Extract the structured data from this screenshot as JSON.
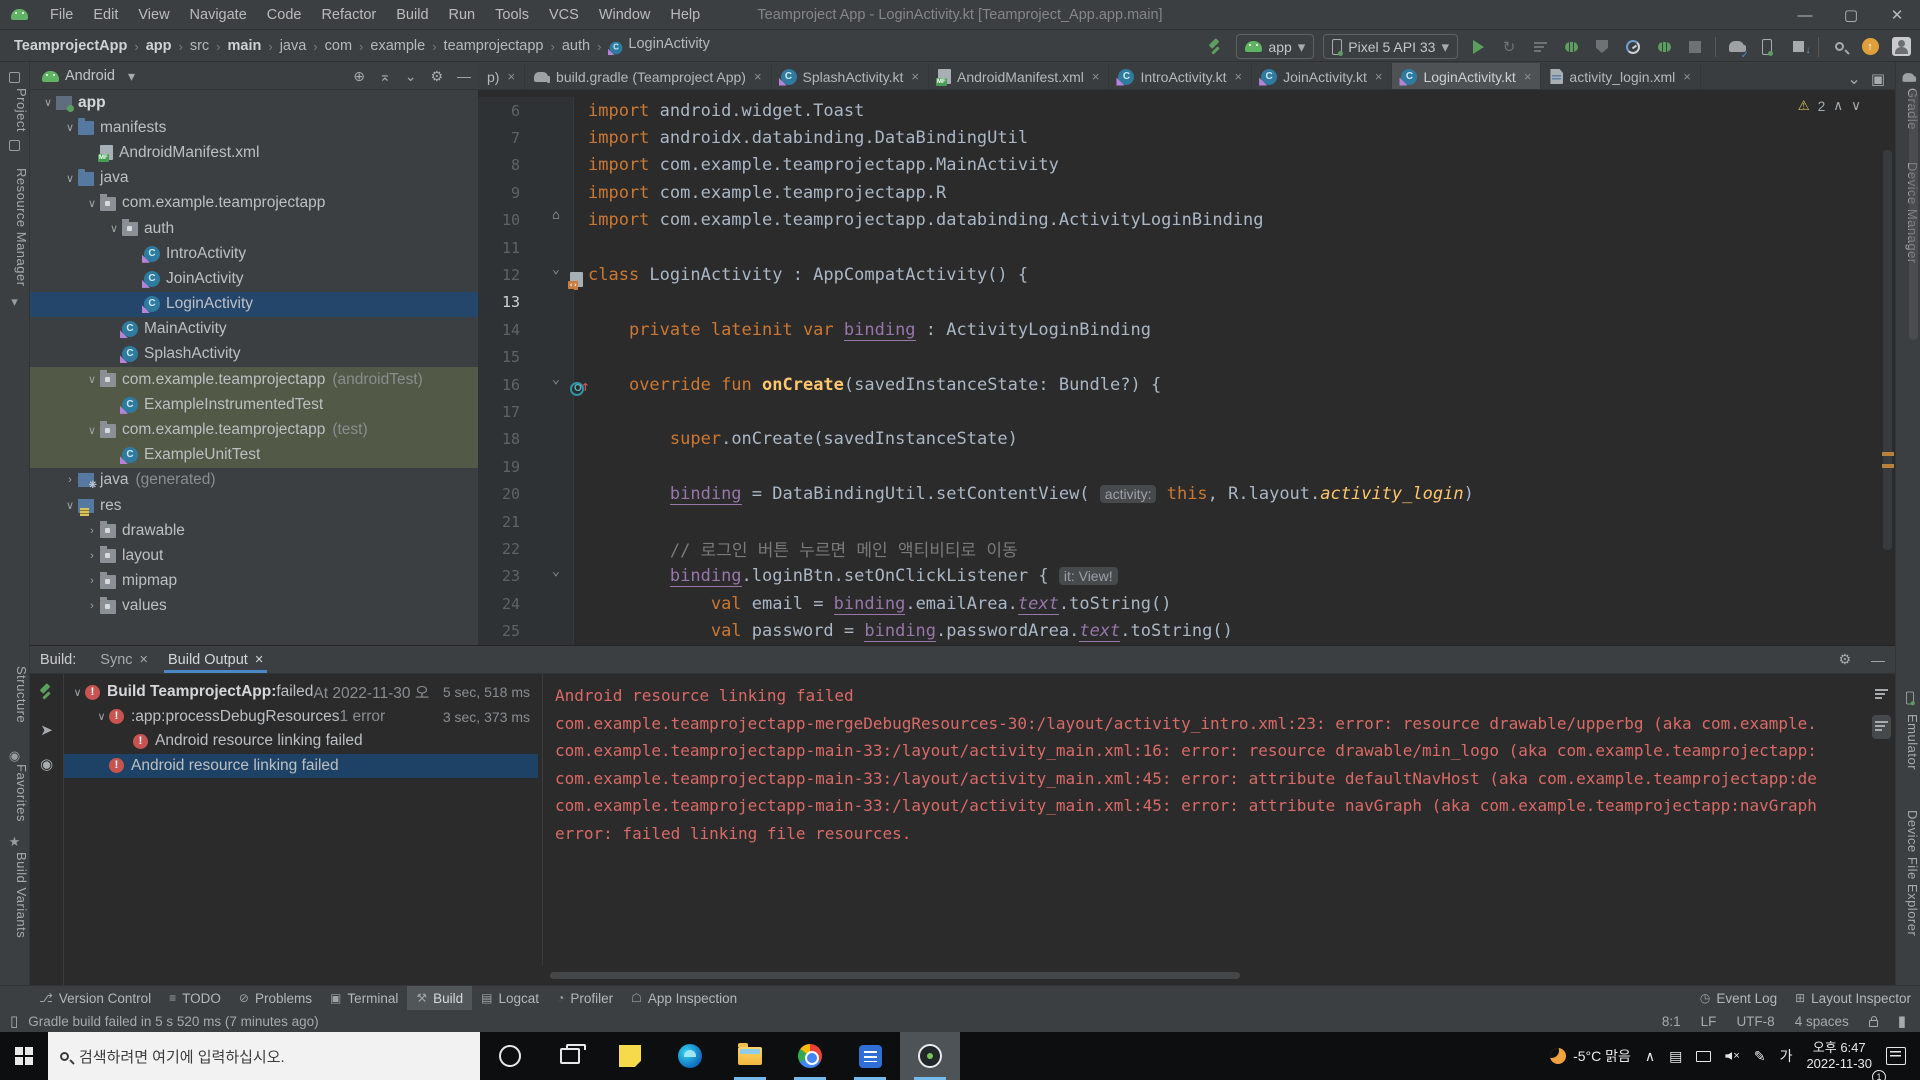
{
  "titlebar": {
    "title": "Teamproject App - LoginActivity.kt [Teamproject_App.app.main]",
    "menus": [
      "File",
      "Edit",
      "View",
      "Navigate",
      "Code",
      "Refactor",
      "Build",
      "Run",
      "Tools",
      "VCS",
      "Window",
      "Help"
    ],
    "window_controls": {
      "minimize": "—",
      "maximize": "▢",
      "close": "✕"
    }
  },
  "toolbar": {
    "breadcrumbs": [
      {
        "label": "TeamprojectApp",
        "bold": true
      },
      {
        "label": "app",
        "bold": true
      },
      {
        "label": "src",
        "bold": false
      },
      {
        "label": "main",
        "bold": true
      },
      {
        "label": "java",
        "bold": false
      },
      {
        "label": "com",
        "bold": false
      },
      {
        "label": "example",
        "bold": false
      },
      {
        "label": "teamprojectapp",
        "bold": false
      },
      {
        "label": "auth",
        "bold": false
      },
      {
        "label": "LoginActivity",
        "bold": false,
        "icon": "kotlin-class"
      }
    ],
    "run_config": "app",
    "device": "Pixel 5 API 33"
  },
  "left_strip": {
    "top": [
      "Project",
      "Resource Manager"
    ],
    "bottom": [
      "Structure",
      "Favorites",
      "Build Variants"
    ]
  },
  "right_strip": {
    "top": [
      "Gradle",
      "Device Manager"
    ],
    "bottom": [
      "Emulator",
      "Device File Explorer"
    ]
  },
  "project": {
    "view": "Android",
    "tree": [
      {
        "label": "app",
        "depth": 0,
        "icon": "app",
        "chev": "v",
        "bold": true
      },
      {
        "label": "manifests",
        "depth": 1,
        "icon": "folder",
        "chev": "v"
      },
      {
        "label": "AndroidManifest.xml",
        "depth": 2,
        "icon": "mf",
        "chev": ""
      },
      {
        "label": "java",
        "depth": 1,
        "icon": "folder",
        "chev": "v"
      },
      {
        "label": "com.example.teamprojectapp",
        "depth": 2,
        "icon": "pkg",
        "chev": "v"
      },
      {
        "label": "auth",
        "depth": 3,
        "icon": "pkg",
        "chev": "v"
      },
      {
        "label": "IntroActivity",
        "depth": 4,
        "icon": "kclass",
        "chev": ""
      },
      {
        "label": "JoinActivity",
        "depth": 4,
        "icon": "kclass",
        "chev": ""
      },
      {
        "label": "LoginActivity",
        "depth": 4,
        "icon": "kclass",
        "chev": "",
        "state": "sel"
      },
      {
        "label": "MainActivity",
        "depth": 3,
        "icon": "kclass",
        "chev": ""
      },
      {
        "label": "SplashActivity",
        "depth": 3,
        "icon": "kclass",
        "chev": ""
      },
      {
        "label": "com.example.teamprojectapp",
        "meta": "(androidTest)",
        "depth": 2,
        "icon": "pkg",
        "chev": "v",
        "state": "olive"
      },
      {
        "label": "ExampleInstrumentedTest",
        "depth": 3,
        "icon": "kclass",
        "chev": "",
        "state": "olive"
      },
      {
        "label": "com.example.teamprojectapp",
        "meta": "(test)",
        "depth": 2,
        "icon": "pkg",
        "chev": "v",
        "state": "olive"
      },
      {
        "label": "ExampleUnitTest",
        "depth": 3,
        "icon": "kclass",
        "chev": "",
        "state": "olive"
      },
      {
        "label": "java",
        "meta": "(generated)",
        "depth": 1,
        "icon": "gen",
        "chev": ">"
      },
      {
        "label": "res",
        "depth": 1,
        "icon": "res",
        "chev": "v"
      },
      {
        "label": "drawable",
        "depth": 2,
        "icon": "pkg",
        "chev": ">"
      },
      {
        "label": "layout",
        "depth": 2,
        "icon": "pkg",
        "chev": ">"
      },
      {
        "label": "mipmap",
        "depth": 2,
        "icon": "pkg",
        "chev": ">"
      },
      {
        "label": "values",
        "depth": 2,
        "icon": "pkg",
        "chev": ">"
      }
    ]
  },
  "editor": {
    "tabs": [
      {
        "label": "p)",
        "icon": "",
        "active": false
      },
      {
        "label": "build.gradle (Teamproject App)",
        "icon": "gradleT",
        "active": false
      },
      {
        "label": "SplashActivity.kt",
        "icon": "kclass",
        "active": false
      },
      {
        "label": "AndroidManifest.xml",
        "icon": "mf",
        "active": false
      },
      {
        "label": "IntroActivity.kt",
        "icon": "kclass",
        "active": false
      },
      {
        "label": "JoinActivity.kt",
        "icon": "kclass",
        "active": false
      },
      {
        "label": "LoginActivity.kt",
        "icon": "kclass",
        "active": true
      },
      {
        "label": "activity_login.xml",
        "icon": "xml",
        "active": false
      }
    ],
    "warning_count": "2",
    "lines": [
      {
        "num": "6",
        "seg": [
          [
            "k",
            "import "
          ],
          [
            "d",
            "android.widget.Toast"
          ]
        ]
      },
      {
        "num": "7",
        "seg": [
          [
            "k",
            "import "
          ],
          [
            "d",
            "androidx.databinding.DataBindingUtil"
          ]
        ]
      },
      {
        "num": "8",
        "seg": [
          [
            "k",
            "import "
          ],
          [
            "d",
            "com.example.teamprojectapp.MainActivity"
          ]
        ]
      },
      {
        "num": "9",
        "seg": [
          [
            "k",
            "import "
          ],
          [
            "d",
            "com.example.teamprojectapp.R"
          ]
        ]
      },
      {
        "num": "10",
        "fold": "⌂",
        "seg": [
          [
            "k",
            "import "
          ],
          [
            "d",
            "com.example.teamprojectapp.databinding.ActivityLoginBinding"
          ]
        ]
      },
      {
        "num": "11",
        "seg": []
      },
      {
        "num": "12",
        "gicon": "activity",
        "fold": "⌄",
        "seg": [
          [
            "k",
            "class "
          ],
          [
            "d",
            "LoginActivity : AppCompatActivity() {"
          ]
        ]
      },
      {
        "num": "13",
        "caret": true,
        "seg": []
      },
      {
        "num": "14",
        "seg": [
          [
            "d",
            "    "
          ],
          [
            "k",
            "private lateinit var "
          ],
          [
            "p",
            "binding"
          ],
          [
            "d",
            " : ActivityLoginBinding"
          ]
        ]
      },
      {
        "num": "15",
        "seg": []
      },
      {
        "num": "16",
        "gicon": "override",
        "fold": "⌄",
        "seg": [
          [
            "d",
            "    "
          ],
          [
            "k",
            "override fun "
          ],
          [
            "f",
            "onCreate"
          ],
          [
            "d",
            "(savedInstanceState: Bundle?) {"
          ]
        ]
      },
      {
        "num": "17",
        "seg": []
      },
      {
        "num": "18",
        "seg": [
          [
            "d",
            "        "
          ],
          [
            "k",
            "super"
          ],
          [
            "d",
            ".onCreate(savedInstanceState)"
          ]
        ]
      },
      {
        "num": "19",
        "seg": []
      },
      {
        "num": "20",
        "seg": [
          [
            "d",
            "        "
          ],
          [
            "p",
            "binding"
          ],
          [
            "d",
            " = DataBindingUtil.setContentView( "
          ],
          [
            "h",
            "activity:"
          ],
          [
            "d",
            " "
          ],
          [
            "k",
            "this"
          ],
          [
            "d",
            ", R.layout."
          ],
          [
            "i",
            "activity_login"
          ],
          [
            "d",
            ")"
          ]
        ]
      },
      {
        "num": "21",
        "seg": []
      },
      {
        "num": "22",
        "seg": [
          [
            "d",
            "        "
          ],
          [
            "c",
            "// 로그인 버튼 누르면 메인 액티비티로 이동"
          ]
        ]
      },
      {
        "num": "23",
        "fold": "⌄",
        "seg": [
          [
            "d",
            "        "
          ],
          [
            "p",
            "binding"
          ],
          [
            "d",
            ".loginBtn.setOnClickListener { "
          ],
          [
            "h",
            "it: View!"
          ]
        ]
      },
      {
        "num": "24",
        "seg": [
          [
            "d",
            "            "
          ],
          [
            "k",
            "val "
          ],
          [
            "d",
            "email = "
          ],
          [
            "p",
            "binding"
          ],
          [
            "d",
            ".emailArea."
          ],
          [
            "pi",
            "text"
          ],
          [
            "d",
            ".toString()"
          ]
        ]
      },
      {
        "num": "25",
        "seg": [
          [
            "d",
            "            "
          ],
          [
            "k",
            "val "
          ],
          [
            "d",
            "password = "
          ],
          [
            "p",
            "binding"
          ],
          [
            "d",
            ".passwordArea."
          ],
          [
            "pi",
            "text"
          ],
          [
            "d",
            ".toString()"
          ]
        ]
      }
    ]
  },
  "build": {
    "panel_label": "Build:",
    "tabs": [
      {
        "label": "Sync",
        "active": false
      },
      {
        "label": "Build Output",
        "active": true
      }
    ],
    "tree": [
      {
        "depth": 0,
        "chev": "v",
        "bold": "Build TeamprojectApp:",
        "text": " failed ",
        "gray": "At 2022-11-30 오",
        "right": "5 sec, 518 ms"
      },
      {
        "depth": 1,
        "chev": "v",
        "bold": "",
        "text": ":app:processDebugResources",
        "gray": "  1 error",
        "right": "3 sec, 373 ms"
      },
      {
        "depth": 2,
        "chev": "",
        "bold": "",
        "text": "Android resource linking failed",
        "gray": "",
        "right": ""
      },
      {
        "depth": 1,
        "chev": "",
        "bold": "",
        "text": "Android resource linking failed",
        "gray": "",
        "right": "",
        "selected": true
      }
    ],
    "console": [
      "Android resource linking failed",
      "com.example.teamprojectapp-mergeDebugResources-30:/layout/activity_intro.xml:23: error: resource drawable/upperbg (aka com.example.",
      "com.example.teamprojectapp-main-33:/layout/activity_main.xml:16: error: resource drawable/min_logo (aka com.example.teamprojectapp:",
      "com.example.teamprojectapp-main-33:/layout/activity_main.xml:45: error: attribute defaultNavHost (aka com.example.teamprojectapp:de",
      "com.example.teamprojectapp-main-33:/layout/activity_main.xml:45: error: attribute navGraph (aka com.example.teamprojectapp:navGraph",
      "error: failed linking file resources."
    ]
  },
  "toolwindow_bar": {
    "left": [
      "Version Control",
      "TODO",
      "Problems",
      "Terminal",
      "Build",
      "Logcat",
      "Profiler",
      "App Inspection"
    ],
    "active": "Build",
    "right": [
      "Event Log",
      "Layout Inspector"
    ]
  },
  "status_bar": {
    "message": "Gradle build failed in 5 s 520 ms (7 minutes ago)",
    "right_items": [
      "8:1",
      "LF",
      "UTF-8",
      "4 spaces"
    ]
  },
  "taskbar": {
    "search_placeholder": "검색하려면 여기에 입력하십시오.",
    "weather": "-5°C 맑음",
    "ime": "가",
    "time": "오후 6:47",
    "date": "2022-11-30",
    "notification_badge": "1"
  }
}
